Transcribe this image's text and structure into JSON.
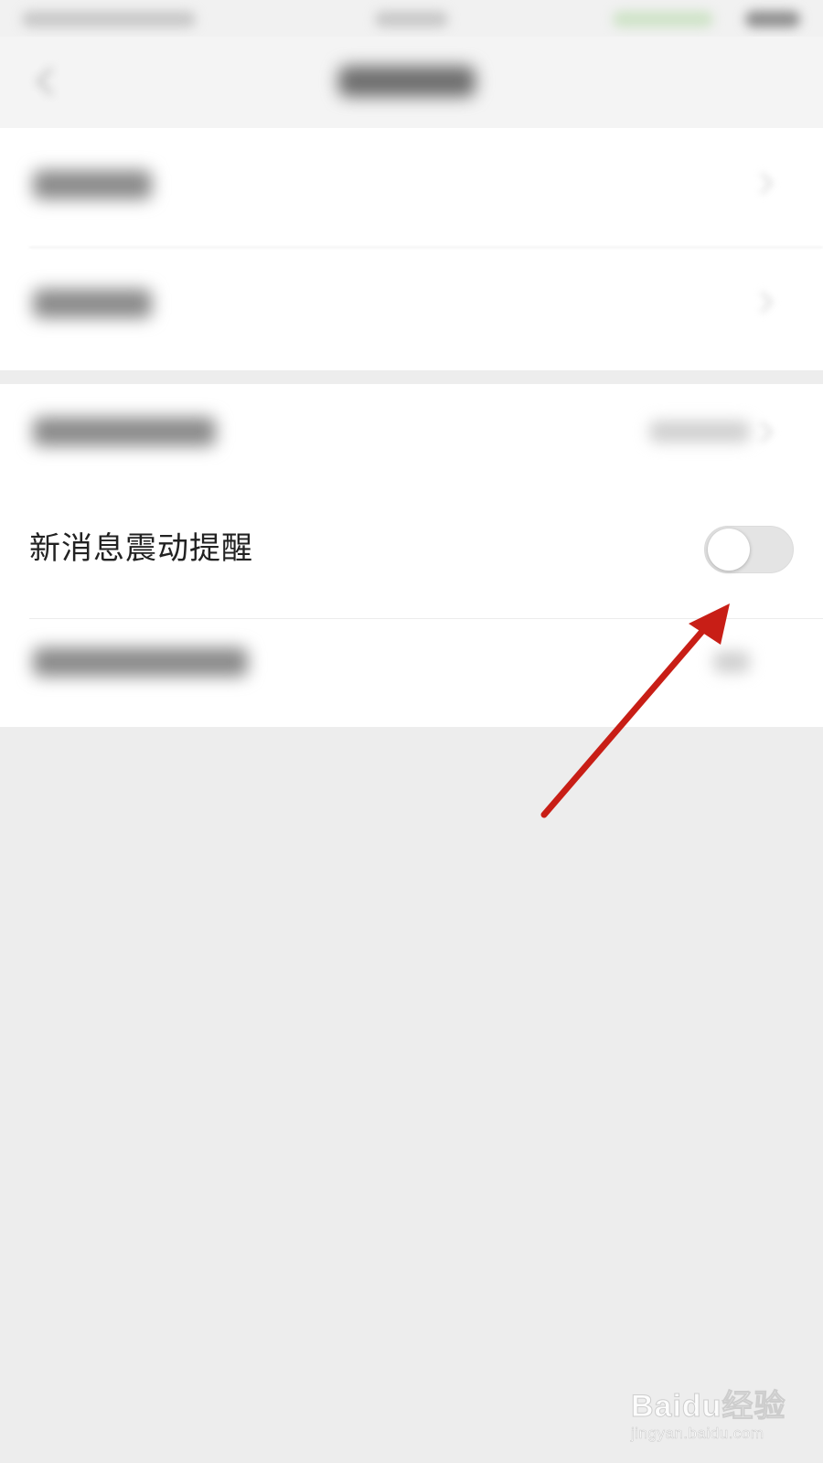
{
  "settings": {
    "vibrate_row": {
      "label": "新消息震动提醒",
      "toggle_on": false
    }
  },
  "colors": {
    "page_background": "#ededed",
    "row_background": "#ffffff",
    "toggle_off_track": "#e4e4e4",
    "annotation_arrow": "#c81e16"
  },
  "watermark": {
    "brand": "Baidu经验",
    "url": "jingyan.baidu.com"
  }
}
